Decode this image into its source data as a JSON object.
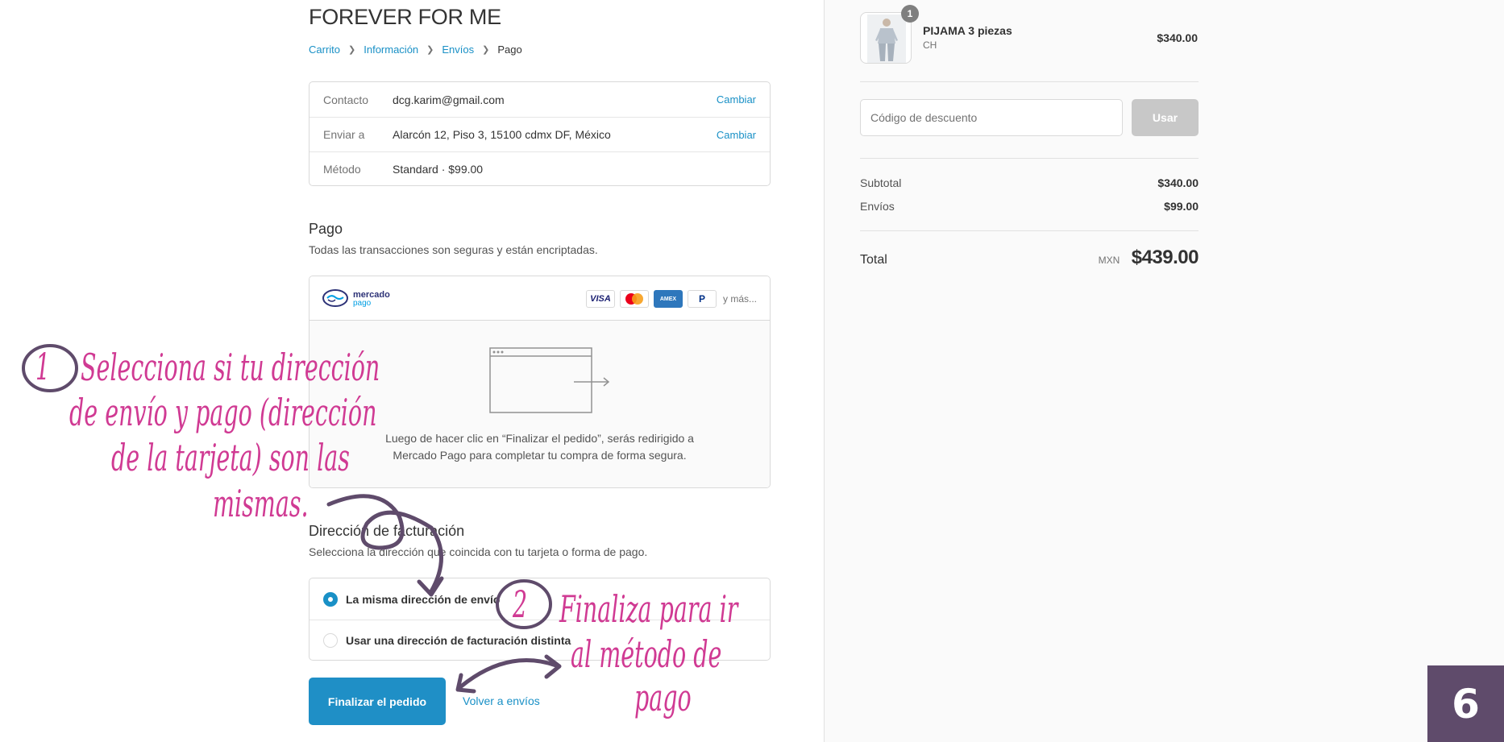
{
  "store": {
    "title": "FOREVER FOR ME"
  },
  "breadcrumb": {
    "items": [
      {
        "label": "Carrito"
      },
      {
        "label": "Información"
      },
      {
        "label": "Envíos"
      }
    ],
    "current": "Pago"
  },
  "review": {
    "rows": [
      {
        "label": "Contacto",
        "value": "dcg.karim@gmail.com",
        "action": "Cambiar"
      },
      {
        "label": "Enviar a",
        "value": "Alarcón 12, Piso 3, 15100 cdmx DF, México",
        "action": "Cambiar"
      },
      {
        "label": "Método",
        "value": "Standard · $99.00"
      }
    ]
  },
  "payment": {
    "title": "Pago",
    "subtitle": "Todas las transacciones son seguras y están encriptadas.",
    "provider_logo_line1": "mercado",
    "provider_logo_line2": "pago",
    "cards": [
      "VISA",
      "AMEX",
      "P"
    ],
    "more": "y más...",
    "message_line1": "Luego de hacer clic en “Finalizar el pedido”, serás redirigido a",
    "message_line2": "Mercado Pago para completar tu compra de forma segura."
  },
  "billing": {
    "title": "Dirección de facturación",
    "subtitle": "Selecciona la dirección que coincida con tu tarjeta o forma de pago.",
    "options": [
      {
        "label": "La misma dirección de envío",
        "selected": true
      },
      {
        "label": "Usar una dirección de facturación distinta",
        "selected": false
      }
    ]
  },
  "actions": {
    "finish": "Finalizar el pedido",
    "back": "Volver a envíos"
  },
  "summary": {
    "product": {
      "name": "PIJAMA 3 piezas",
      "variant": "CH",
      "price": "$340.00",
      "quantity": "1"
    },
    "discount": {
      "placeholder": "Código de descuento",
      "button": "Usar"
    },
    "subtotal_label": "Subtotal",
    "subtotal_value": "$340.00",
    "shipping_label": "Envíos",
    "shipping_value": "$99.00",
    "total_label": "Total",
    "currency": "MXN",
    "total_value": "$439.00"
  },
  "annotations": {
    "step1_number": "1",
    "step1_line1": "Selecciona si tu dirección",
    "step1_line2": "de envío y pago (dirección",
    "step1_line3": "de la tarjeta) son las",
    "step1_line4": "mismas.",
    "step2_number": "2",
    "step2_line1": "Finaliza para ir",
    "step2_line2": "al método de",
    "step2_line3": "pago",
    "page_number": "6",
    "colors": {
      "annotation": "#d03a93",
      "arrow": "#5f4b6b",
      "accent": "#1990c6"
    }
  }
}
